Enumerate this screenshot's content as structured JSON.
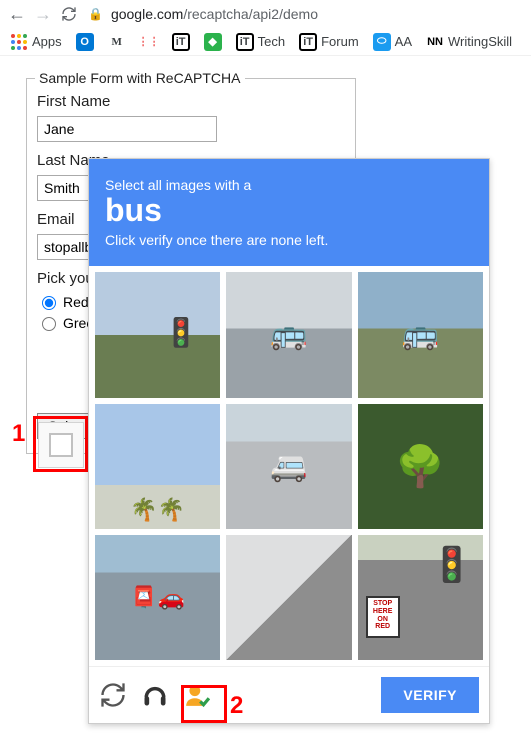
{
  "browser": {
    "url_domain": "google.com",
    "url_path": "/recaptcha/api2/demo"
  },
  "bookmarks": {
    "apps": "Apps",
    "tech": "Tech",
    "forum": "Forum",
    "aa": "AA",
    "writing": "WritingSkill"
  },
  "form": {
    "title": "Sample Form with ReCAPTCHA",
    "first_name_label": "First Name",
    "first_name_value": "Jane",
    "last_name_label": "Last Name",
    "last_name_value": "Smith",
    "email_label": "Email",
    "email_value": "stopallbots@gmail.com",
    "color_label": "Pick your favorite color:",
    "color_red": "Red",
    "color_green": "Green",
    "submit": "Submit"
  },
  "recaptcha": {
    "line1": "Select all images with a",
    "target": "bus",
    "line2": "Click verify once there are none left.",
    "verify": "VERIFY",
    "stop_sign_text": "STOP HERE ON RED"
  },
  "annotations": {
    "1": "1",
    "2": "2"
  }
}
